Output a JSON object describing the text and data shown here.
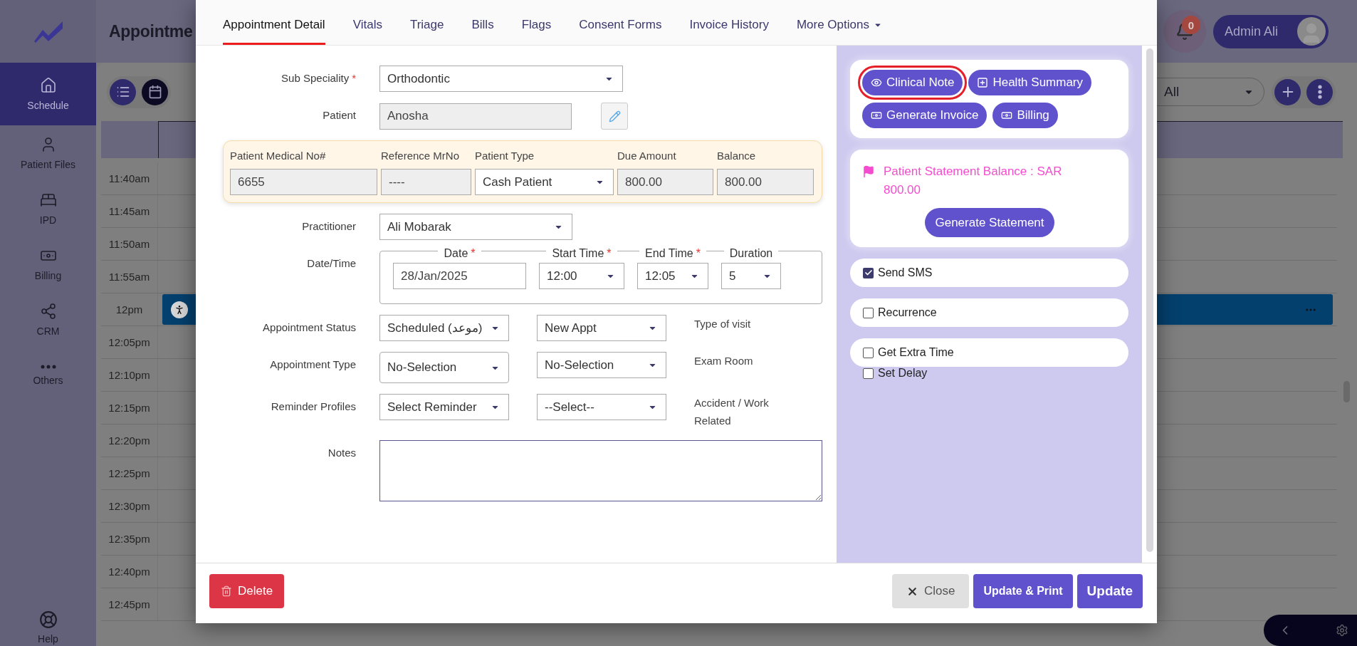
{
  "header": {
    "title": "Appointme",
    "notification_count": "0",
    "user_name": "Admin Ali"
  },
  "sidebar": {
    "items": [
      {
        "label": "Schedule",
        "selected": true
      },
      {
        "label": "Patient Files",
        "selected": false
      },
      {
        "label": "IPD",
        "selected": false
      },
      {
        "label": "Billing",
        "selected": false
      },
      {
        "label": "CRM",
        "selected": false
      },
      {
        "label": "Others",
        "selected": false
      }
    ],
    "help": "Help"
  },
  "toolbar": {
    "filter": "All"
  },
  "schedule": {
    "rows": [
      {
        "time": "11:40am",
        "booked": false
      },
      {
        "time": "11:45am",
        "booked": false
      },
      {
        "time": "11:50am",
        "booked": false
      },
      {
        "time": "11:55am",
        "booked": false
      },
      {
        "time": "12pm",
        "booked": true
      },
      {
        "time": "12:05pm",
        "booked": false
      },
      {
        "time": "12:10pm",
        "booked": false
      },
      {
        "time": "12:15pm",
        "booked": false
      },
      {
        "time": "12:20pm",
        "booked": false
      },
      {
        "time": "12:25pm",
        "booked": false
      },
      {
        "time": "12:30pm",
        "booked": false
      },
      {
        "time": "12:35pm",
        "booked": false
      },
      {
        "time": "12:40pm",
        "booked": false
      },
      {
        "time": "12:45pm",
        "booked": false
      }
    ]
  },
  "modal": {
    "tabs": [
      {
        "label": "Appointment Detail",
        "selected": true,
        "has_menu": false
      },
      {
        "label": "Vitals",
        "selected": false,
        "has_menu": false
      },
      {
        "label": "Triage",
        "selected": false,
        "has_menu": false
      },
      {
        "label": "Bills",
        "selected": false,
        "has_menu": false
      },
      {
        "label": "Flags",
        "selected": false,
        "has_menu": false
      },
      {
        "label": "Consent Forms",
        "selected": false,
        "has_menu": false
      },
      {
        "label": "Invoice History",
        "selected": false,
        "has_menu": false
      },
      {
        "label": "More Options",
        "selected": false,
        "has_menu": true
      }
    ],
    "sub_speciality": {
      "label": "Sub Speciality",
      "required_mark": "*",
      "value": "Orthodontic"
    },
    "patient": {
      "label": "Patient",
      "value": "Anosha",
      "disabled": true
    },
    "patient_info": [
      {
        "label": "Patient Medical No#",
        "value": "6655",
        "kind": "text"
      },
      {
        "label": "Reference MrNo",
        "value": "----",
        "kind": "text"
      },
      {
        "label": "Patient Type",
        "value": "Cash Patient",
        "kind": "select"
      },
      {
        "label": "Due Amount",
        "value": "800.00",
        "kind": "text"
      },
      {
        "label": "Balance",
        "value": "800.00",
        "kind": "text"
      }
    ],
    "practitioner": {
      "label": "Practitioner",
      "value": "Ali Mobarak"
    },
    "date_time": {
      "label": "Date/Time",
      "fields": [
        {
          "legend": "Date",
          "required_mark": "*",
          "value": "28/Jan/2025",
          "kind": "text"
        },
        {
          "legend": "Start Time",
          "required_mark": "*",
          "value": "12:00",
          "kind": "select"
        },
        {
          "legend": "End Time",
          "required_mark": "*",
          "value": "12:05",
          "kind": "select"
        },
        {
          "legend": "Duration",
          "value": "5",
          "kind": "select"
        }
      ]
    },
    "select_rows": [
      {
        "label": "Appointment Status",
        "values": [
          "Scheduled (موعد)",
          "New Appt"
        ],
        "side_label": "Type of visit"
      },
      {
        "label": "Appointment Type",
        "values": [
          "No-Selection",
          "No-Selection"
        ],
        "side_label": "Exam Room"
      },
      {
        "label": "Reminder Profiles",
        "values": [
          "Select Reminder",
          "--Select--"
        ],
        "side_label": "Accident / Work Related"
      }
    ],
    "notes": {
      "label": "Notes"
    },
    "actions": [
      {
        "label": "Clinical Note",
        "kind": "view",
        "highlighted": true
      },
      {
        "label": "Health Summary",
        "kind": "add",
        "highlighted": false
      },
      {
        "label": "Generate Invoice",
        "kind": "money",
        "highlighted": false
      },
      {
        "label": "Billing",
        "kind": "money",
        "highlighted": false
      }
    ],
    "statement": {
      "text": "Patient Statement Balance : SAR 800.00",
      "button": "Generate Statement"
    },
    "options": [
      {
        "label": "Send SMS",
        "checked": true,
        "kind": "pill"
      },
      {
        "label": "Recurrence",
        "checked": false,
        "kind": "pill"
      },
      {
        "label": "Get Extra Time",
        "checked": false,
        "kind": "pill"
      },
      {
        "label": "Set Delay",
        "checked": false,
        "kind": "plain"
      }
    ],
    "footer": {
      "delete": "Delete",
      "close": "Close",
      "update_print": "Update & Print",
      "update": "Update"
    }
  }
}
